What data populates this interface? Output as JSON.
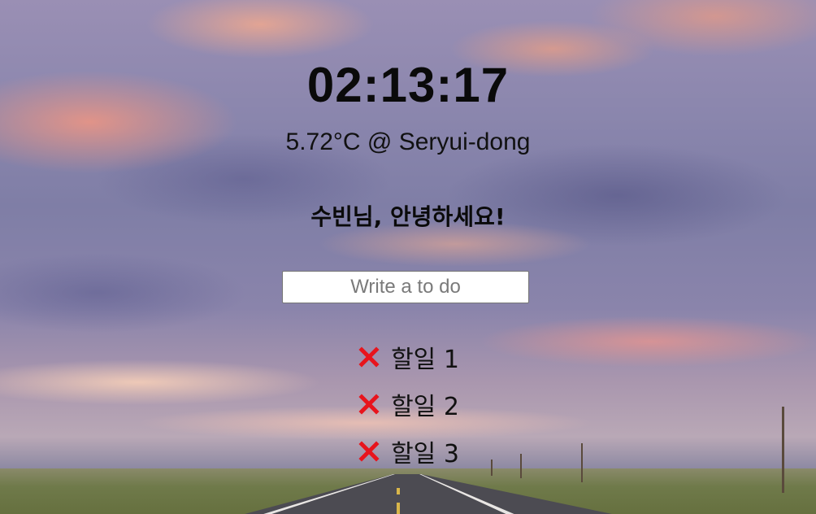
{
  "clock": {
    "time": "02:13:17"
  },
  "weather": {
    "text": "5.72°C @ Seryui-dong"
  },
  "greeting": {
    "text": "수빈님, 안녕하세요!"
  },
  "todo_form": {
    "placeholder": "Write a to do",
    "value": ""
  },
  "todos": [
    {
      "text": "할일 1",
      "delete_icon": "close-icon"
    },
    {
      "text": "할일 2",
      "delete_icon": "close-icon"
    },
    {
      "text": "할일 3",
      "delete_icon": "close-icon"
    }
  ],
  "colors": {
    "delete_icon": "#e8141c",
    "text": "#0a0a0a",
    "input_bg": "#ffffff"
  }
}
